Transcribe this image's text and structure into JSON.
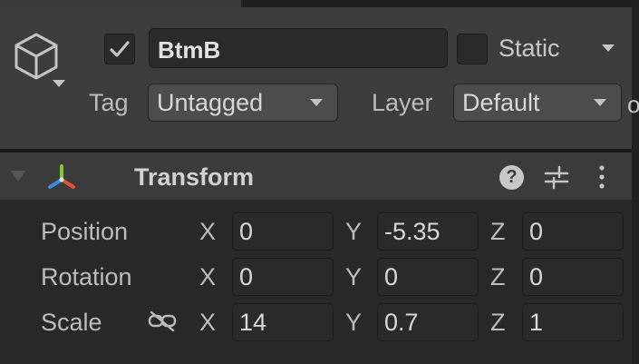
{
  "gameobject": {
    "active": true,
    "name": "BtmB",
    "static_checked": false,
    "static_label": "Static",
    "tag_label": "Tag",
    "tag_value": "Untagged",
    "layer_label": "Layer",
    "layer_value": "Default",
    "clipped_glyph": "o"
  },
  "component": {
    "title": "Transform",
    "help_glyph": "?",
    "position": {
      "label": "Position",
      "x": "0",
      "y": "-5.35",
      "z": "0"
    },
    "rotation": {
      "label": "Rotation",
      "x": "0",
      "y": "0",
      "z": "0"
    },
    "scale": {
      "label": "Scale",
      "x": "14",
      "y": "0.7",
      "z": "1"
    }
  },
  "axes": {
    "x": "X",
    "y": "Y",
    "z": "Z"
  },
  "icons": {
    "gameobject": "cube-icon",
    "active": "checkmark-icon",
    "foldout": "foldout-arrow-icon",
    "transform": "transform-icon",
    "help": "help-icon",
    "presets": "presets-icon",
    "menu": "kebab-menu-icon",
    "scale_link": "unlinked-chain-icon"
  },
  "colors": {
    "panel": "#3c3c3c",
    "field": "#2a2a2a",
    "dropdown": "#4c4c4c",
    "gizmo_y": "#7ec932",
    "gizmo_x": "#e1512d",
    "gizmo_z": "#3a8ee0"
  }
}
